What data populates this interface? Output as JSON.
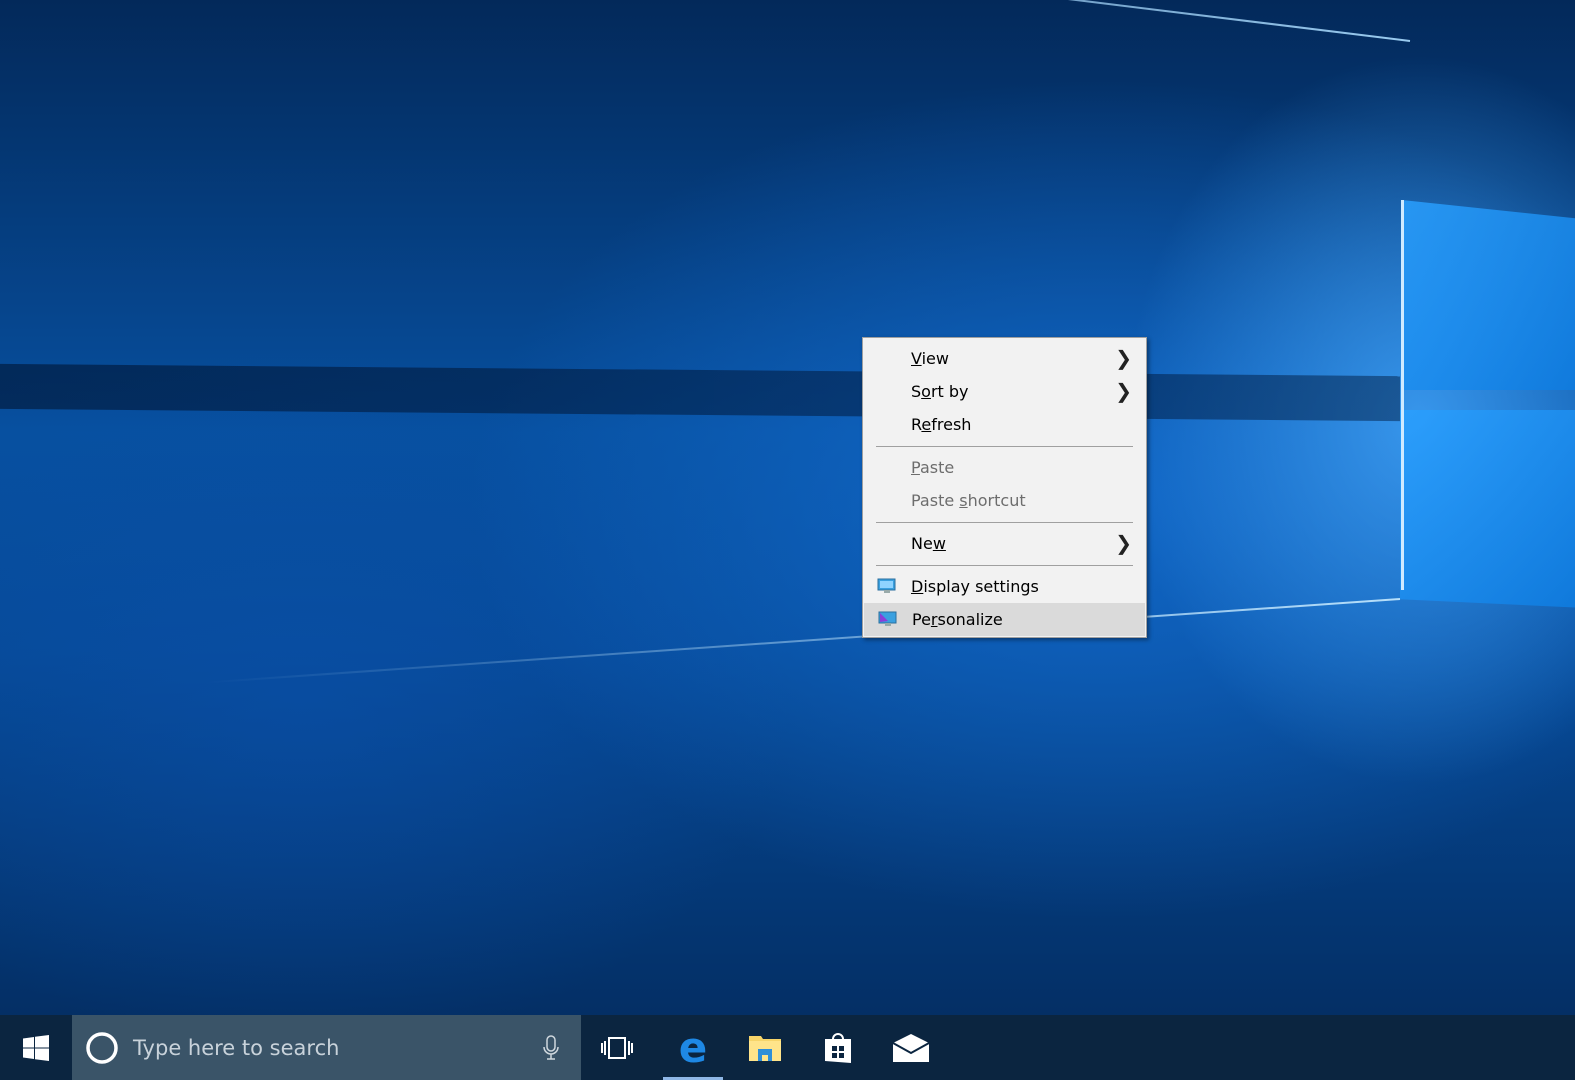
{
  "context_menu": {
    "items": [
      {
        "pre": "",
        "key": "V",
        "post": "iew",
        "submenu": true,
        "disabled": false
      },
      {
        "pre": "S",
        "key": "o",
        "post": "rt by",
        "submenu": true,
        "disabled": false
      },
      {
        "pre": "R",
        "key": "e",
        "post": "fresh",
        "submenu": false,
        "disabled": false
      },
      {
        "pre": "",
        "key": "P",
        "post": "aste",
        "submenu": false,
        "disabled": true
      },
      {
        "pre": "Paste ",
        "key": "s",
        "post": "hortcut",
        "submenu": false,
        "disabled": true
      },
      {
        "pre": "Ne",
        "key": "w",
        "post": "",
        "submenu": true,
        "disabled": false
      },
      {
        "pre": "",
        "key": "D",
        "post": "isplay settings",
        "submenu": false,
        "disabled": false,
        "icon": "display-icon"
      },
      {
        "pre": "Pe",
        "key": "r",
        "post": "sonalize",
        "submenu": false,
        "disabled": false,
        "icon": "personalize-icon",
        "highlighted": true
      }
    ]
  },
  "taskbar": {
    "search_placeholder": "Type here to search",
    "icons": [
      "windows-start-icon",
      "cortana-icon",
      "microphone-icon",
      "task-view-icon",
      "edge-icon",
      "file-explorer-icon",
      "store-icon",
      "mail-icon"
    ],
    "active_app": "edge"
  },
  "colors": {
    "accent": "#0078d7",
    "taskbar": "#0b2540",
    "search": "#3a5468",
    "menu": "#f2f2f2"
  }
}
